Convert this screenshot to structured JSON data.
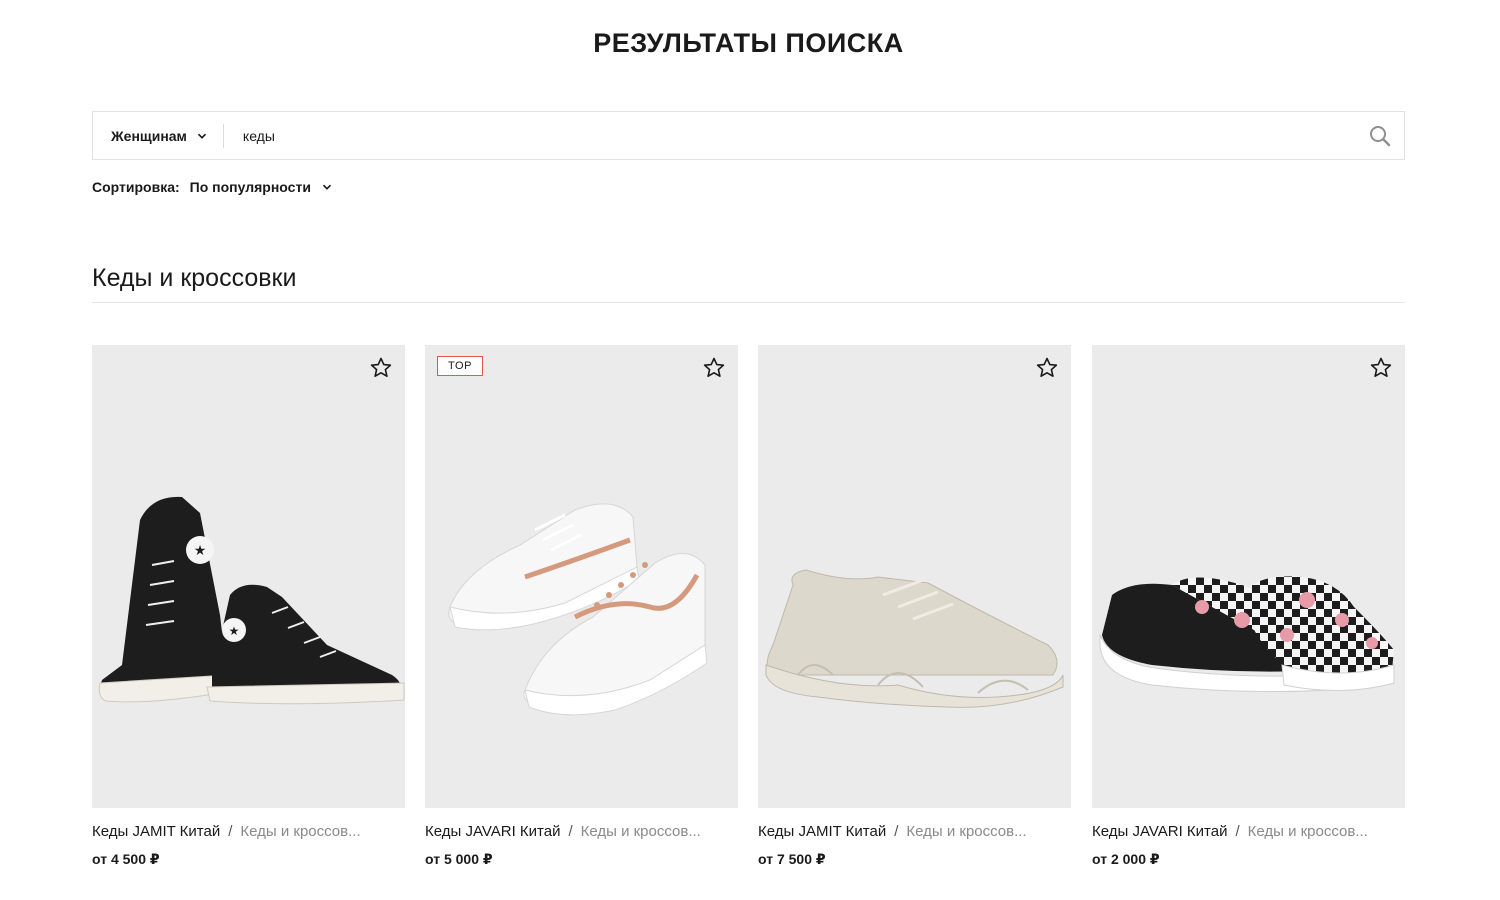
{
  "page": {
    "title": "РЕЗУЛЬТАТЫ ПОИСКА"
  },
  "search": {
    "category_label": "Женщинам",
    "query": "кеды",
    "search_icon": "search-icon"
  },
  "sort": {
    "label": "Сортировка:",
    "value": "По популярности"
  },
  "section": {
    "title": "Кеды и кроссовки"
  },
  "colors": {
    "badge_border": "#e0584e",
    "card_bg": "#ebebeb",
    "muted_text": "#8a8a8a"
  },
  "products": [
    {
      "name": "Кеды JAMIT Китай",
      "sep": "/",
      "category": "Кеды и кроссов...",
      "price": "от 4 500 ₽",
      "badge": null,
      "icon": "star-outline-icon"
    },
    {
      "name": "Кеды JAVARI Китай",
      "sep": "/",
      "category": "Кеды и кроссов...",
      "price": "от 5 000 ₽",
      "badge": "TOP",
      "icon": "star-outline-icon"
    },
    {
      "name": "Кеды JAMIT Китай",
      "sep": "/",
      "category": "Кеды и кроссов...",
      "price": "от 7 500 ₽",
      "badge": null,
      "icon": "star-outline-icon"
    },
    {
      "name": "Кеды JAVARI Китай",
      "sep": "/",
      "category": "Кеды и кроссов...",
      "price": "от 2 000 ₽",
      "badge": null,
      "icon": "star-outline-icon"
    }
  ]
}
